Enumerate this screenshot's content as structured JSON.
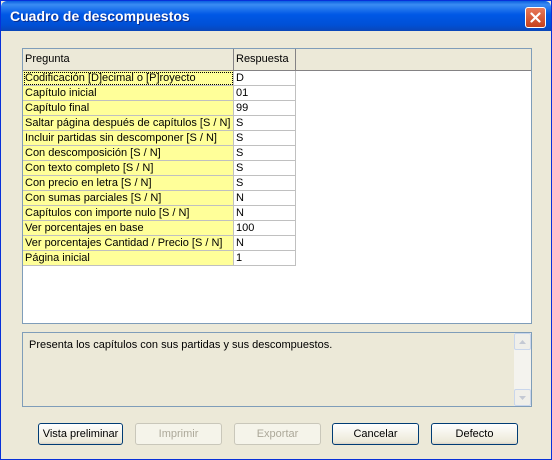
{
  "window": {
    "title": "Cuadro de descompuestos"
  },
  "grid": {
    "headers": {
      "question": "Pregunta",
      "answer": "Respuesta"
    },
    "rows": [
      {
        "q": "Codificación [D]ecimal o [P]royecto",
        "a": "D"
      },
      {
        "q": "Capítulo inicial",
        "a": "01"
      },
      {
        "q": "Capítulo final",
        "a": "99"
      },
      {
        "q": "Saltar página después de capítulos [S / N]",
        "a": "S"
      },
      {
        "q": "Incluir partidas sin descomponer [S / N]",
        "a": "S"
      },
      {
        "q": "Con descomposición [S / N]",
        "a": "S"
      },
      {
        "q": "Con texto completo [S / N]",
        "a": "S"
      },
      {
        "q": "Con precio en letra [S / N]",
        "a": "S"
      },
      {
        "q": "Con sumas parciales [S / N]",
        "a": "N"
      },
      {
        "q": "Capítulos con importe nulo [S / N]",
        "a": "N"
      },
      {
        "q": "Ver porcentajes en base",
        "a": "100"
      },
      {
        "q": "Ver porcentajes Cantidad / Precio [S / N]",
        "a": "N"
      },
      {
        "q": "Página inicial",
        "a": "1"
      }
    ]
  },
  "description": {
    "text": "Presenta los capítulos con sus partidas y sus descompuestos."
  },
  "buttons": {
    "preview": "Vista preliminar",
    "print": "Imprimir",
    "export": "Exportar",
    "cancel": "Cancelar",
    "default": "Defecto"
  }
}
